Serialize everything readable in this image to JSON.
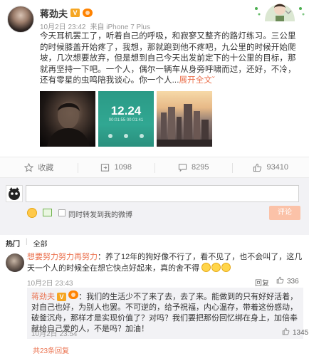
{
  "post": {
    "author": "蒋劲夫",
    "vip_badge": "V",
    "meta": {
      "time": "10月2日 23:42",
      "source_prefix": "来自",
      "source": "iPhone 7 Plus"
    },
    "text_main": "今天耳机罢工了，听着自己的呼吸，和寂寥又整齐的路灯练习。三公里的时候膝盖开始疼了，我想，那就跑到他不疼吧，九公里的时候开始爬坡，几次想要放弃，但是想到自己今天出发前定下的十公里的目标，那就再坚持一下吧。一个人，偶尔一辆车从身旁呼啸而过，还好，不冷，还有零星的虫鸣陪我谈心。你一个人",
    "ellipsis": "...",
    "expand_label": "展开全文",
    "expand_chevron": "ˇ",
    "photo2_time": "12.24",
    "photo2_sub": "00:01:55  00:01:41"
  },
  "actions": [
    {
      "name": "favorite",
      "icon": "star-icon",
      "label": "收藏"
    },
    {
      "name": "repost",
      "icon": "repost-icon",
      "label": "1098"
    },
    {
      "name": "comment",
      "icon": "comment-icon",
      "label": "8295"
    },
    {
      "name": "like",
      "icon": "thumbs-up-icon",
      "label": "93410"
    }
  ],
  "composer": {
    "repost_label": "同时转发到我的微博",
    "submit_label": "评论"
  },
  "comments": {
    "tab_hot": "热门",
    "tab_sep": "|",
    "tab_all": "全部",
    "c1": {
      "user": "想要努力努力再努力",
      "colon": "：",
      "text": "养了12年的狗好像不行了，看不见了，也不会叫了，这几天一个人的时候全在想它快点好起来，真的舍不得",
      "time": "10月2日 23:43",
      "reply": "回复",
      "likes": "336"
    },
    "reply": {
      "user": "蒋劲夫",
      "colon": "：",
      "text": "我们的生活少不了来了去，去了来。能做到的只有好好活着，对自己也好，为别人也罢。不可逆的，给予祝福，内心温存，带着这份感动，破釜沉舟，那样才是实现价值了？对吗？我们要把那份回忆绑在身上，加倍奉献给自己爱的人，不是吗？加油！",
      "time": "10月2日 23:54",
      "likes": "1345"
    },
    "more": "共23条回复"
  }
}
